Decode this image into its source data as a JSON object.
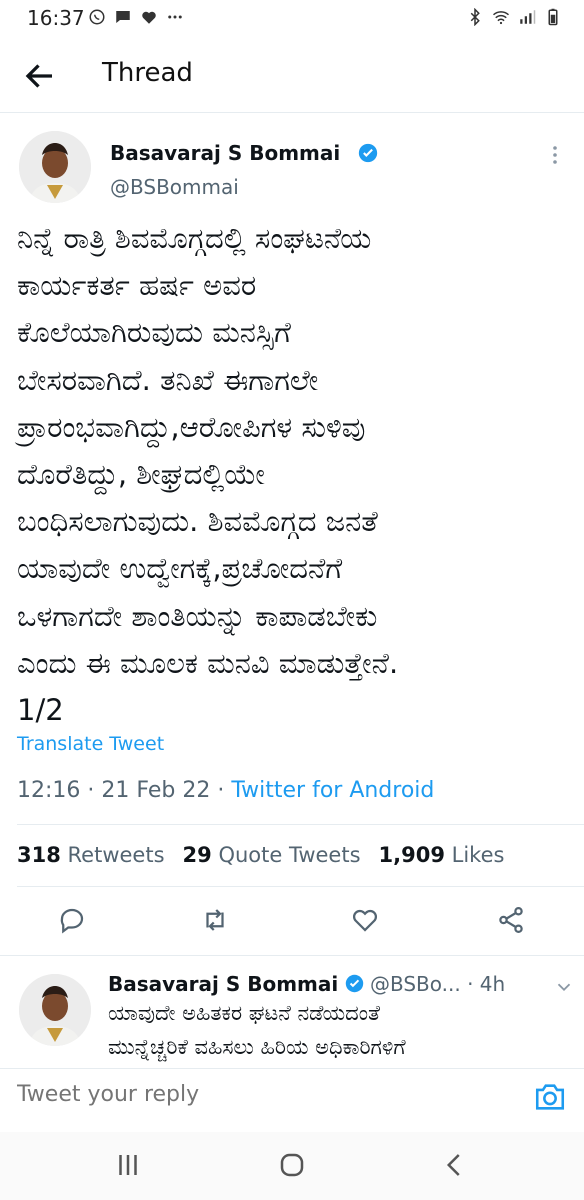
{
  "status_bar": {
    "time": "16:37",
    "left_icons": [
      "whatsapp-icon",
      "message-icon",
      "heart-icon",
      "more-dots-icon"
    ],
    "right_icons": [
      "bluetooth-icon",
      "wifi-icon",
      "signal-icon",
      "battery-icon"
    ]
  },
  "header": {
    "title": "Thread"
  },
  "tweet": {
    "author_name": "Basavaraj S Bommai",
    "author_handle": "@BSBommai",
    "text": "ನಿನ್ನೆ ರಾತ್ರಿ ಶಿವಮೊಗ್ಗದಲ್ಲಿ ಸಂಘಟನೆಯ\nಕಾರ್ಯಕರ್ತ ಹರ್ಷ ಅವರ\nಕೊಲೆಯಾಗಿರುವುದು ಮನಸ್ಸಿಗೆ\nಬೇಸರವಾಗಿದೆ. ತನಿಖೆ ಈಗಾಗಲೇ\nಪ್ರಾರಂಭವಾಗಿದ್ದು,ಆರೋಪಿಗಳ ಸುಳಿವು\nದೊರೆತಿದ್ದು, ಶೀಘ್ರದಲ್ಲಿಯೇ\nಬಂಧಿಸಲಾಗುವುದು. ಶಿವಮೊಗ್ಗದ ಜನತೆ\nಯಾವುದೇ ಉದ್ವೇಗಕ್ಕೆ,ಪ್ರಚೋದನೆಗೆ\nಒಳಗಾಗದೇ ಶಾಂತಿಯನ್ನು ಕಾಪಾಡಬೇಕು\nಎಂದು ಈ ಮೂಲಕ ಮನವಿ ಮಾಡುತ್ತೇನೆ.\n1/2",
    "translate_label": "Translate Tweet",
    "time": "12:16",
    "date": "21 Feb 22",
    "separator": "·",
    "source": "Twitter for Android",
    "retweets_count": "318",
    "retweets_label": "Retweets",
    "quotes_count": "29",
    "quotes_label": "Quote Tweets",
    "likes_count": "1,909",
    "likes_label": "Likes",
    "actions": [
      "reply-icon",
      "retweet-icon",
      "like-icon",
      "share-icon"
    ]
  },
  "reply_tweet": {
    "author_name": "Basavaraj S Bommai",
    "author_handle": "@BSBo...",
    "separator": "·",
    "age": "4h",
    "text": "ಯಾವುದೇ ಅಹಿತಕರ ಘಟನೆ ನಡೆಯದಂತೆ\nಮುನ್ನೆಚ್ಚರಿಕೆ ವಹಿಸಲು ಹಿರಿಯ ಅಧಿಕಾರಿಗಳಿಗೆ"
  },
  "reply_bar": {
    "placeholder": "Tweet your reply"
  },
  "colors": {
    "accent": "#1d9bf0",
    "secondary_text": "#536471",
    "primary_text": "#0f1419"
  }
}
